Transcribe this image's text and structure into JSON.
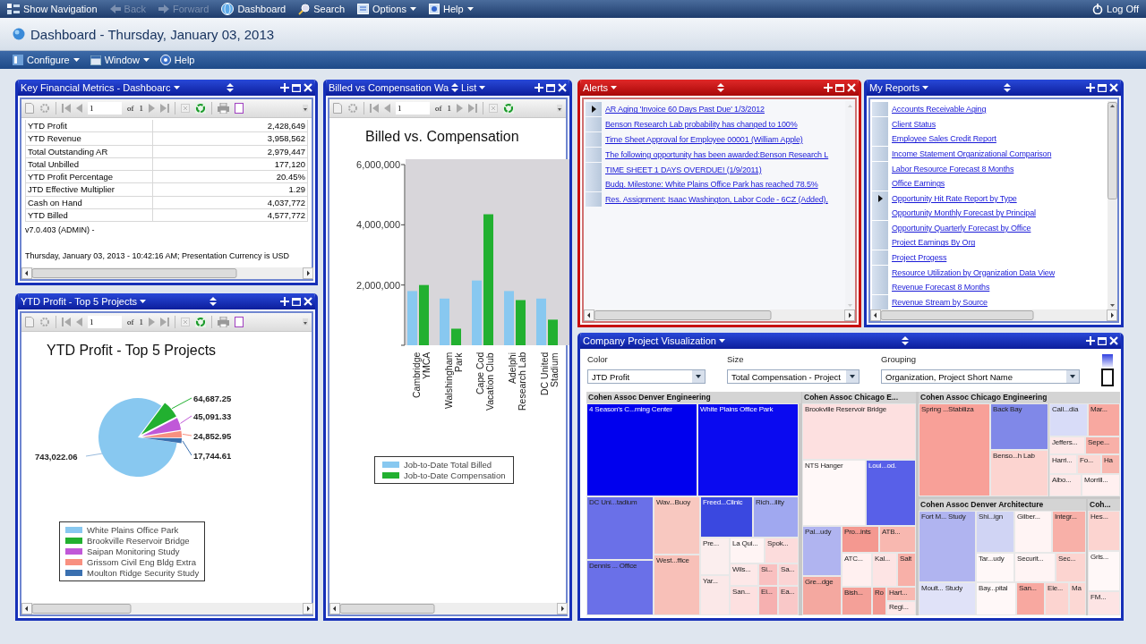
{
  "nav": {
    "items": [
      {
        "label": "Show Navigation",
        "disabled": false,
        "dropdown": false
      },
      {
        "label": "Back",
        "disabled": true,
        "dropdown": false
      },
      {
        "label": "Forward",
        "disabled": true,
        "dropdown": false
      },
      {
        "label": "Dashboard",
        "disabled": false,
        "dropdown": false
      },
      {
        "label": "Search",
        "disabled": false,
        "dropdown": false
      },
      {
        "label": "Options",
        "disabled": false,
        "dropdown": true
      },
      {
        "label": "Help",
        "disabled": false,
        "dropdown": true
      }
    ],
    "logoff": "Log Off"
  },
  "page_title": "Dashboard - Thursday, January 03, 2013",
  "toolbar": [
    {
      "label": "Configure",
      "dropdown": true
    },
    {
      "label": "Window",
      "dropdown": true
    },
    {
      "label": "Help",
      "dropdown": false
    }
  ],
  "metrics_panel": {
    "title": "Key Financial Metrics - Dashboarc",
    "kind": "normal",
    "report_toolbar": {
      "page": "1",
      "of": "of",
      "total": "1",
      "print": true
    },
    "rows": [
      {
        "label": "YTD Profit",
        "value": "2,428,649"
      },
      {
        "label": "YTD Revenue",
        "value": "3,958,562"
      },
      {
        "label": "Total Outstanding AR",
        "value": "2,979,447"
      },
      {
        "label": "Total Unbilled",
        "value": "177,120"
      },
      {
        "label": "YTD Profit Percentage",
        "value": "20.45%"
      },
      {
        "label": "JTD Effective Multiplier",
        "value": "1.29"
      },
      {
        "label": "Cash on Hand",
        "value": "4,037,772"
      },
      {
        "label": "YTD Billed",
        "value": "4,577,772"
      }
    ],
    "version": "v7.0.403 (ADMIN) -",
    "footer": "Thursday, January 03, 2013 - 10:42:16 AM; Presentation Currency is USD"
  },
  "profit_panel": {
    "title": "YTD Profit - Top 5 Projects",
    "kind": "normal",
    "report_toolbar": {
      "page": "1",
      "of": "of",
      "total": "1",
      "print": true
    },
    "chart_data": {
      "type": "pie",
      "title": "YTD Profit - Top 5 Projects",
      "categories": [
        "White Plains Office Park",
        "Brookville Reservoir Bridge",
        "Saipan Monitoring Study",
        "Grissom Civil Eng Bldg Extra",
        "Moulton Ridge Security Study"
      ],
      "values": [
        743022.06,
        64687.25,
        45091.33,
        24852.95,
        17744.61
      ],
      "colors": [
        "#88c8f0",
        "#22b030",
        "#c058d8",
        "#f89080",
        "#3a70b0"
      ],
      "legend": "bottom",
      "value_labels": [
        "743,022.06",
        "64,687.25",
        "45,091.33",
        "24,852.95",
        "17,744.61"
      ]
    }
  },
  "billed_panel": {
    "title": "Billed vs Compensation Wa",
    "suffix": "List",
    "kind": "normal",
    "report_toolbar": {
      "page": "1",
      "of": "of",
      "total": "1",
      "print": false
    },
    "chart_data": {
      "type": "bar",
      "title": "Billed vs. Compensation",
      "categories": [
        "Cambridge YMCA",
        "Walshingham Park",
        "Cape Cod Vacation Club",
        "Adelphi Research Lab",
        "DC United Stadium"
      ],
      "series": [
        {
          "name": "Job-to-Date Total Billed",
          "color": "#88c8f0",
          "values": [
            1800000,
            1550000,
            2150000,
            1800000,
            1550000
          ]
        },
        {
          "name": "Job-to-Date Compensation",
          "color": "#22b030",
          "values": [
            2000000,
            550000,
            4350000,
            1500000,
            850000
          ]
        }
      ],
      "legend": "bottom",
      "ylim": [
        0,
        6000000
      ],
      "yticks": [
        {
          "value": 2000000,
          "label": "2,000,000"
        },
        {
          "value": 4000000,
          "label": "4,000,000"
        },
        {
          "value": 6000000,
          "label": "6,000,000"
        }
      ]
    }
  },
  "alerts_panel": {
    "title": "Alerts",
    "kind": "alert",
    "items": [
      {
        "text": "AR Aging 'Invoice 60 Days Past Due' 1/3/2012",
        "selected": true
      },
      {
        "text": "Benson Research Lab probability has changed to 100%",
        "selected": false
      },
      {
        "text": "Time Sheet Approval for Employee 00001 (William Apple)",
        "selected": false
      },
      {
        "text": "The following opportunity has been awarded:Benson Research L",
        "selected": false
      },
      {
        "text": "TIME SHEET 1 DAYS OVERDUE! (1/9/2011)",
        "selected": false
      },
      {
        "text": "Budg. Milestone: White Plains Office Park has reached 78.5%",
        "selected": false
      },
      {
        "text": "Res. Assignment: Isaac Washington, Labor Code - 6CZ (Added),",
        "selected": false
      }
    ]
  },
  "reports_panel": {
    "title": "My Reports",
    "kind": "normal",
    "items": [
      {
        "text": "Accounts Receivable Aging",
        "selected": false
      },
      {
        "text": "Client Status",
        "selected": false
      },
      {
        "text": "Employee Sales Credit Report",
        "selected": false
      },
      {
        "text": "Income Statement Organizational Comparison",
        "selected": false
      },
      {
        "text": "Labor Resource Forecast 8 Months",
        "selected": false
      },
      {
        "text": "Office Earnings",
        "selected": false
      },
      {
        "text": "Opportunity Hit Rate Report by Type",
        "selected": true
      },
      {
        "text": "Opportunity Monthly Forecast by Principal",
        "selected": false
      },
      {
        "text": "Opportunity Quarterly Forecast by Office",
        "selected": false
      },
      {
        "text": "Project Earnings By Org",
        "selected": false
      },
      {
        "text": "Project Progess",
        "selected": false
      },
      {
        "text": "Resource Utilization by Organization Data View",
        "selected": false
      },
      {
        "text": "Revenue Forecast 8 Months",
        "selected": false
      },
      {
        "text": "Revenue Stream by Source",
        "selected": false
      }
    ]
  },
  "visualization_panel": {
    "title": "Company Project Visualization",
    "kind": "normal",
    "controls": [
      {
        "label": "Color",
        "value": "JTD Profit"
      },
      {
        "label": "Size",
        "value": "Total Compensation - Project"
      },
      {
        "label": "Grouping",
        "value": "Organization, Project Short Name"
      }
    ],
    "groups": [
      {
        "name": "Cohen Assoc Denver Engineering",
        "tiles": [
          {
            "name": "4 Season's C...rning Center",
            "color": "#0000ee"
          },
          {
            "name": "White Plains Office Park",
            "color": "#0a0af0"
          },
          {
            "name": "DC Uni...tadium",
            "color": "#6a70e8"
          },
          {
            "name": "Dennis ... Office",
            "color": "#6a70e8"
          },
          {
            "name": "Wav...Buoy",
            "color": "#f8c8c0"
          },
          {
            "name": "West...ffice",
            "color": "#f8c0b8"
          },
          {
            "name": "Freed...Clinic",
            "color": "#3a48e0"
          },
          {
            "name": "Rich...ility",
            "color": "#a0a8f0"
          },
          {
            "name": "Pre...",
            "color": "#fbeeee"
          },
          {
            "name": "Yar...",
            "color": "#fbe8e8"
          },
          {
            "name": "La Qui...",
            "color": "#fff4f4"
          },
          {
            "name": "Spok...",
            "color": "#fcdcdc"
          },
          {
            "name": "Wils...",
            "color": "#fde8e8"
          },
          {
            "name": "San...",
            "color": "#fde0e0"
          },
          {
            "name": "Si...",
            "color": "#f9c0c0"
          },
          {
            "name": "Sa...",
            "color": "#fbd4d4"
          },
          {
            "name": "Ei...",
            "color": "#f6b0b0"
          },
          {
            "name": "Ea...",
            "color": "#f9c8c8"
          }
        ]
      },
      {
        "name": "Cohen Assoc Chicago E...",
        "tiles": [
          {
            "name": "Brookville Reservoir Bridge",
            "color": "#fde0e0"
          },
          {
            "name": "NTS Hanger",
            "color": "#fff8f8"
          },
          {
            "name": "Loui...od.",
            "color": "#5860e8"
          },
          {
            "name": "Pal...udy",
            "color": "#b0b4f0"
          },
          {
            "name": "Gre...dge",
            "color": "#f4a8a0"
          },
          {
            "name": "Pro...ints",
            "color": "#f49890"
          },
          {
            "name": "ATB...",
            "color": "#f8b8b0"
          },
          {
            "name": "ATC...",
            "color": "#fff0f0"
          },
          {
            "name": "Kal...",
            "color": "#fde4e4"
          },
          {
            "name": "Salt",
            "color": "#f8b0a8"
          },
          {
            "name": "Bish...",
            "color": "#f4a098"
          },
          {
            "name": "Ro",
            "color": "#f29890"
          },
          {
            "name": "Hart...",
            "color": "#f8b8b0"
          },
          {
            "name": "Regi...",
            "color": "#fde8e8"
          }
        ]
      },
      {
        "name": "Cohen Assoc Chicago Engineering",
        "tiles": [
          {
            "name": "Spring ...Stabiliza",
            "color": "#f8a098"
          },
          {
            "name": "Back Bay",
            "color": "#8088e8"
          },
          {
            "name": "Benso...h Lab",
            "color": "#fcd4d0"
          },
          {
            "name": "Call...dia",
            "color": "#d8dcf8"
          },
          {
            "name": "Mar...",
            "color": "#f8a8a0"
          },
          {
            "name": "Jeffers...",
            "color": "#fde8e8"
          },
          {
            "name": "Sepe...",
            "color": "#f8b0a8"
          },
          {
            "name": "Harri...",
            "color": "#fde8e8"
          },
          {
            "name": "Fo...",
            "color": "#fcd8d4"
          },
          {
            "name": "Ha",
            "color": "#f8b8b0"
          },
          {
            "name": "Albo...",
            "color": "#fde8e8"
          },
          {
            "name": "Morrill...",
            "color": "#fff0f0"
          }
        ]
      },
      {
        "name": "Cohen Assoc Denver Architecture",
        "tiles": [
          {
            "name": "Fort M... Study",
            "color": "#b0b4f0"
          },
          {
            "name": "Moult... Study",
            "color": "#e0e2f8"
          },
          {
            "name": "Shi...ign",
            "color": "#d0d4f4"
          },
          {
            "name": "Tar...udy",
            "color": "#fff8f8"
          },
          {
            "name": "Bay...pital",
            "color": "#fff8f8"
          },
          {
            "name": "Gilber...",
            "color": "#fff4f4"
          },
          {
            "name": "Integr...",
            "color": "#f8b0a8"
          },
          {
            "name": "Securit...",
            "color": "#fff4f4"
          },
          {
            "name": "Sec...",
            "color": "#fcd4d0"
          },
          {
            "name": "San...",
            "color": "#f8a8a0"
          },
          {
            "name": "Ele...",
            "color": "#fcd4d0"
          },
          {
            "name": "Ma",
            "color": "#fcd8d4"
          }
        ]
      },
      {
        "name": "Coh...",
        "tiles": [
          {
            "name": "Hes...",
            "color": "#fcd4d0"
          },
          {
            "name": "Gris...",
            "color": "#fff8f8"
          },
          {
            "name": "FM...",
            "color": "#fde4e4"
          }
        ]
      }
    ]
  }
}
